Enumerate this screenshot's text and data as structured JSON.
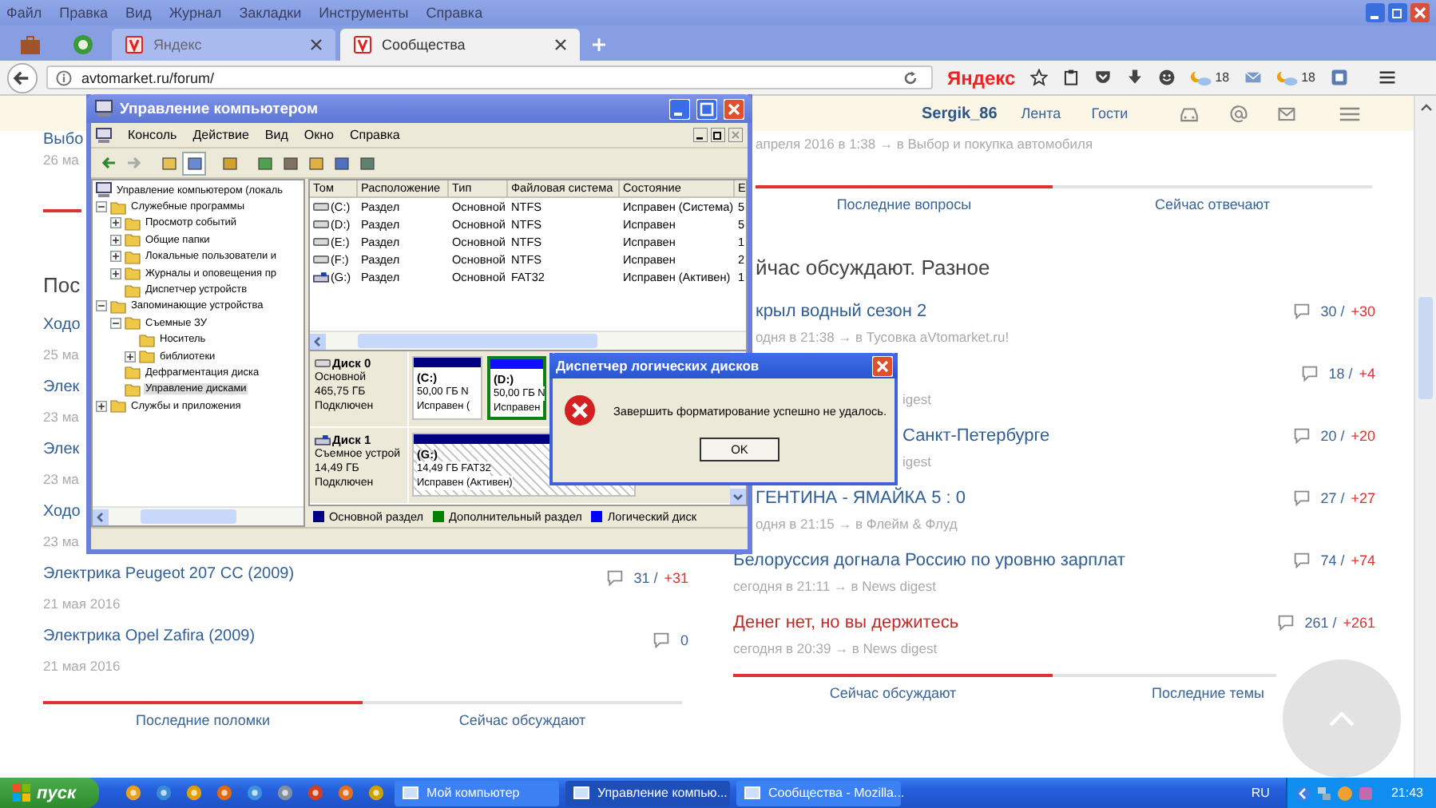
{
  "browser": {
    "menu": [
      "Файл",
      "Правка",
      "Вид",
      "Журнал",
      "Закладки",
      "Инструменты",
      "Справка"
    ],
    "tabs": [
      {
        "kind": "pinned",
        "selected": false
      },
      {
        "kind": "pinned",
        "selected": false
      },
      {
        "kind": "page",
        "label": "Яндекс",
        "selected": false
      },
      {
        "kind": "page",
        "label": "Сообщества",
        "selected": true
      }
    ],
    "url": "avtomarket.ru/forum/",
    "search_logo": "Яндекс",
    "weather": [
      "18",
      "18"
    ]
  },
  "page": {
    "header": {
      "user": "Sergik_86",
      "links": [
        "Лента",
        "Гости"
      ]
    },
    "left": {
      "top_entry": {
        "title": "Выбо",
        "meta": "26 ма"
      },
      "heading": "Пос",
      "entries": [
        {
          "title": "Ходо",
          "meta": "25 ма"
        },
        {
          "title": "Элек",
          "meta": "23 ма"
        },
        {
          "title": "Элек",
          "meta": "23 ма"
        },
        {
          "title": "Ходо",
          "meta": "23 ма"
        },
        {
          "title": "Электрика Peugeot 207 CC (2009)",
          "meta": "21 мая 2016",
          "comments": "31 /",
          "delta": "+31"
        },
        {
          "title": "Электрика Opel Zafira (2009)",
          "meta": "21 мая 2016",
          "comments": "0"
        }
      ],
      "tabs": [
        {
          "label": "Последние поломки",
          "selected": true
        },
        {
          "label": "Сейчас обсуждают",
          "selected": false
        }
      ]
    },
    "right": {
      "top_meta": "апреля 2016 в 1:38 → в Выбор и покупка автомобиля",
      "top_tabs": [
        {
          "label": "Последние вопросы",
          "selected": true
        },
        {
          "label": "Сейчас отвечают",
          "selected": false
        }
      ],
      "heading": "йчас обсуждают. Разное",
      "items": [
        {
          "title": "крыл водный сезон 2",
          "meta": "одня в 21:38 → в Тусовка aVtomarket.ru!",
          "comments": "30 /",
          "delta": "+30",
          "hot": false
        },
        {
          "meta": "igest",
          "comments": "18 /",
          "delta": "+4"
        },
        {
          "title": "Санкт-Петербурге",
          "meta": "igest",
          "comments": "20 /",
          "delta": "+20",
          "hot": false
        },
        {
          "title": "ГЕНТИНА - ЯМАЙКА 5 : 0",
          "meta": "одня в 21:15 → в Флейм & Флуд",
          "comments": "27 /",
          "delta": "+27",
          "hot": false
        },
        {
          "title": "Белоруссия догнала Россию по уровню зарплат",
          "meta": "сегодня в 21:11 → в News digest",
          "comments": "74 /",
          "delta": "+74",
          "hot": false
        },
        {
          "title": "Денег нет, но вы держитесь",
          "meta": "сегодня в 20:39 → в News digest",
          "comments": "261 /",
          "delta": "+261",
          "hot": true
        }
      ],
      "bottom_tabs": [
        {
          "label": "Сейчас обсуждают",
          "selected": true
        },
        {
          "label": "Последние темы",
          "selected": false
        }
      ]
    }
  },
  "mgmt": {
    "title": "Управление компьютером",
    "menu": [
      "Консоль",
      "Действие",
      "Вид",
      "Окно",
      "Справка"
    ],
    "tree": [
      {
        "label": "Управление компьютером (локаль",
        "selected": false,
        "children": [
          {
            "label": "Служебные программы",
            "expanded": true,
            "selected": false,
            "children": [
              {
                "label": "Просмотр событий",
                "expanded": false,
                "selected": false
              },
              {
                "label": "Общие папки",
                "expanded": false,
                "selected": false
              },
              {
                "label": "Локальные пользователи и",
                "expanded": false,
                "selected": false
              },
              {
                "label": "Журналы и оповещения пр",
                "expanded": false,
                "selected": false
              },
              {
                "label": "Диспетчер устройств",
                "selected": false
              }
            ]
          },
          {
            "label": "Запоминающие устройства",
            "expanded": true,
            "selected": false,
            "children": [
              {
                "label": "Съемные ЗУ",
                "expanded": true,
                "selected": false,
                "children": [
                  {
                    "label": "Носитель",
                    "selected": false
                  },
                  {
                    "label": "библиотеки",
                    "expanded": false,
                    "selected": false
                  }
                ]
              },
              {
                "label": "Дефрагментация диска",
                "selected": false
              },
              {
                "label": "Управление дисками",
                "selected": true
              }
            ]
          },
          {
            "label": "Службы и приложения",
            "expanded": false,
            "selected": false
          }
        ]
      }
    ],
    "columns": [
      "Том",
      "Расположение",
      "Тип",
      "Файловая система",
      "Состояние",
      "Е"
    ],
    "rows": [
      {
        "kind": "fixed",
        "cells": [
          "(C:)",
          "Раздел",
          "Основной",
          "NTFS",
          "Исправен (Система)",
          "5"
        ]
      },
      {
        "kind": "fixed",
        "cells": [
          "(D:)",
          "Раздел",
          "Основной",
          "NTFS",
          "Исправен",
          "5"
        ]
      },
      {
        "kind": "fixed",
        "cells": [
          "(E:)",
          "Раздел",
          "Основной",
          "NTFS",
          "Исправен",
          "1"
        ]
      },
      {
        "kind": "fixed",
        "cells": [
          "(F:)",
          "Раздел",
          "Основной",
          "NTFS",
          "Исправен",
          "2"
        ]
      },
      {
        "kind": "removable",
        "cells": [
          "(G:)",
          "Раздел",
          "Основной",
          "FAT32",
          "Исправен (Активен)",
          "1"
        ]
      }
    ],
    "disks": [
      {
        "kind": "fixed",
        "name": "Диск 0",
        "lines": [
          "Основной",
          "465,75 ГБ",
          "Подключен"
        ],
        "partitions": [
          {
            "kind": "primary",
            "letter": "(C:)",
            "size": "50,00 ГБ N",
            "state": "Исправен (",
            "selected": false
          },
          {
            "kind": "logical",
            "letter": "(D:)",
            "size": "50,00 ГБ N",
            "state": "Исправен",
            "selected": false
          }
        ]
      },
      {
        "kind": "removable",
        "name": "Диск 1",
        "lines": [
          "Съемное устрой",
          "14,49 ГБ",
          "Подключен"
        ],
        "partitions": [
          {
            "kind": "primary",
            "letter": "(G:)",
            "size": "14,49 ГБ FAT32",
            "state": "Исправен (Активен)",
            "selected": true
          }
        ]
      }
    ],
    "legend": [
      {
        "label": "Основной раздел",
        "color": "#000080"
      },
      {
        "label": "Дополнительный раздел",
        "color": "#008000"
      },
      {
        "label": "Логический диск",
        "color": "#0000ff"
      }
    ]
  },
  "dialog": {
    "title": "Диспетчер логических дисков",
    "message": "Завершить форматирование успешно не удалось.",
    "button": "OK"
  },
  "taskbar": {
    "start": "пуск",
    "tasks": [
      {
        "label": "Мой компьютер",
        "selected": false
      },
      {
        "label": "Управление компью...",
        "selected": true
      },
      {
        "label": "Сообщества - Mozilla...",
        "selected": false
      }
    ],
    "lang": "RU",
    "clock": "21:43"
  }
}
